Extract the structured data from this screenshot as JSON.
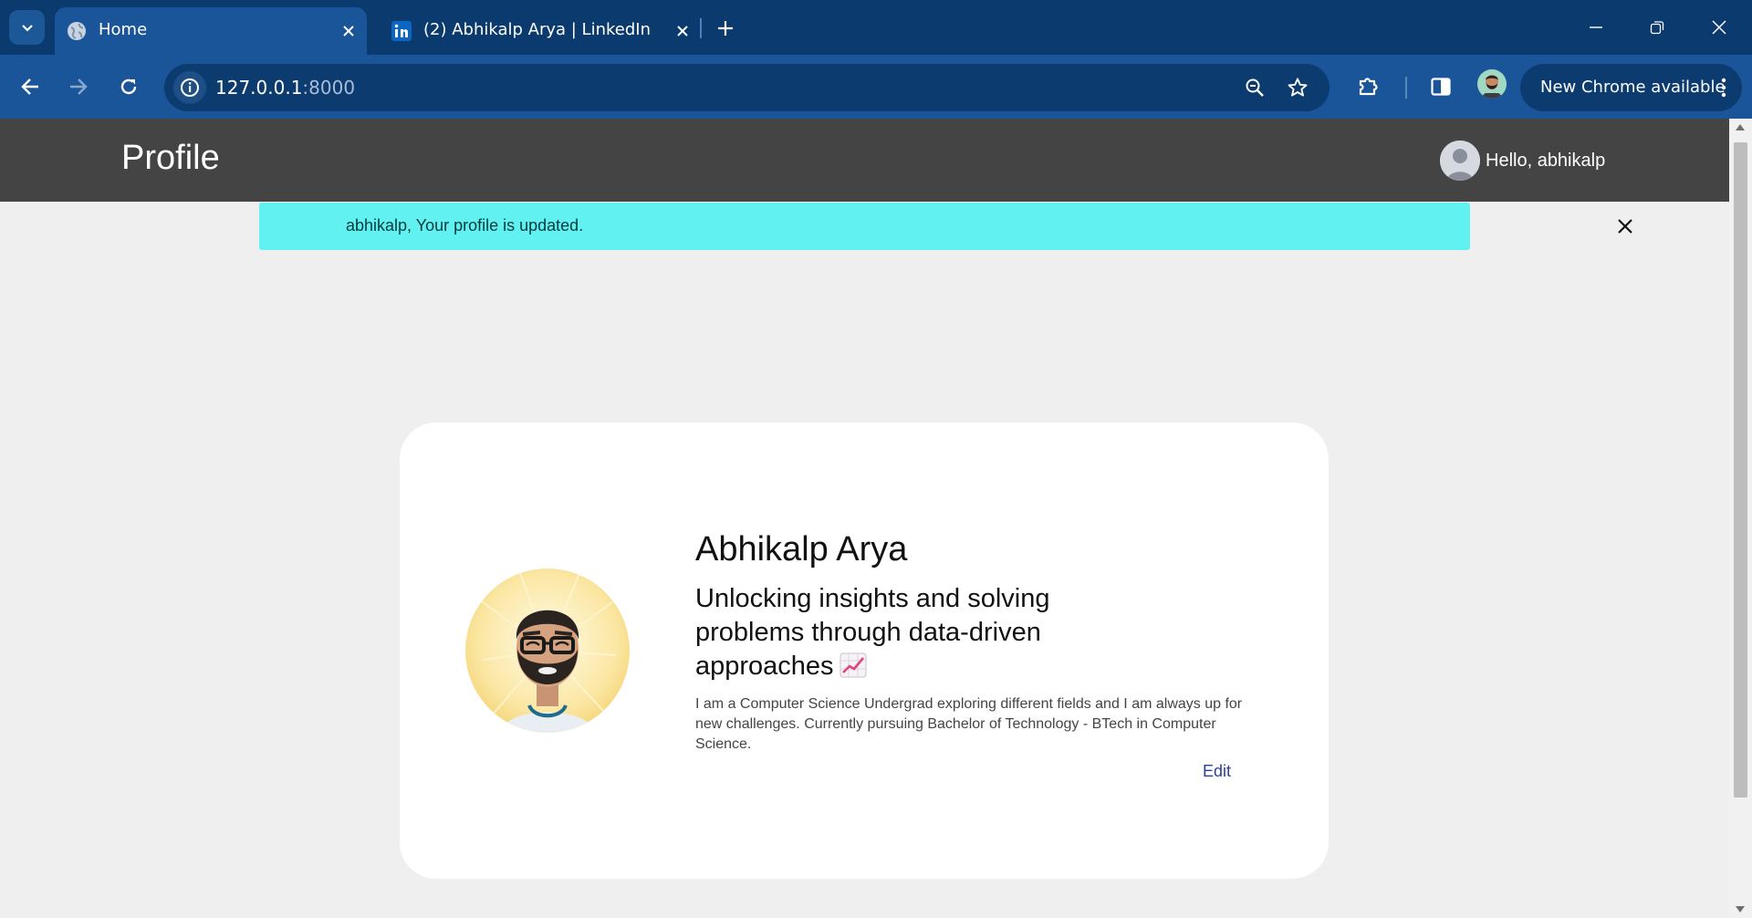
{
  "browser": {
    "tabs": [
      {
        "title": "Home",
        "active": true,
        "favicon": "globe-icon"
      },
      {
        "title": "(2) Abhikalp Arya | LinkedIn",
        "active": false,
        "favicon": "linkedin-icon"
      }
    ],
    "address": {
      "host": "127.0.0.1",
      "port": ":8000"
    },
    "update_button": "New Chrome available",
    "colors": {
      "tabstrip": "#0b3a6e",
      "toolbar": "#1a5599",
      "omnibox": "#0c3b70"
    }
  },
  "site": {
    "brand": "Profile",
    "greeting": "Hello, abhikalp",
    "nav_color": "#444444"
  },
  "alert": {
    "message": "abhikalp, Your profile is updated.",
    "color": "#62f1f1"
  },
  "profile": {
    "name": "Abhikalp Arya",
    "tagline": "Unlocking insights and solving problems through data-driven approaches",
    "tagline_emoji": "chart-increasing-icon",
    "bio": "I am a Computer Science Undergrad exploring different fields and I am always up for new challenges. Currently pursuing Bachelor of Technology - BTech in Computer Science.",
    "edit_label": "Edit"
  }
}
